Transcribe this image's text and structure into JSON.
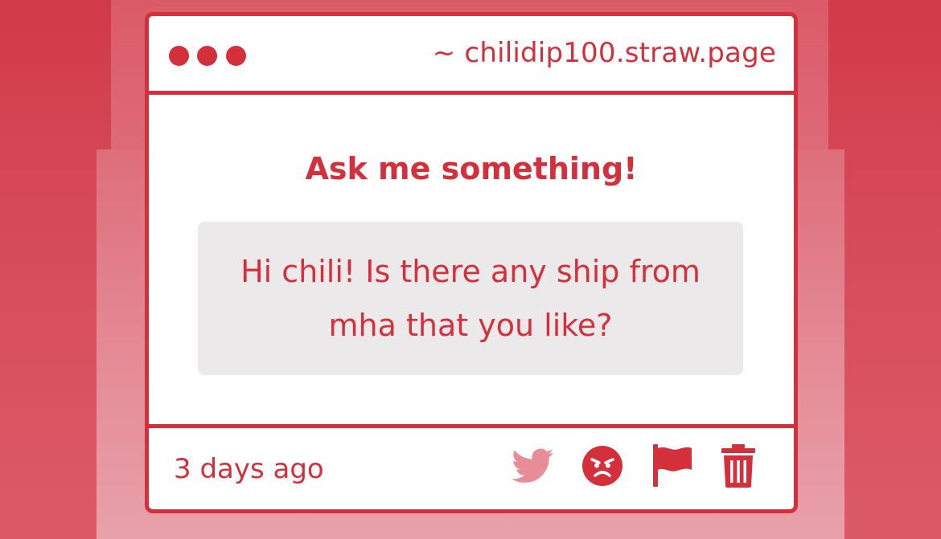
{
  "window": {
    "url": "~ chilidip100.straw.page",
    "accent_color": "#d4303c",
    "dots": [
      "window-dot-1",
      "window-dot-2",
      "window-dot-3"
    ]
  },
  "main": {
    "heading": "Ask me something!",
    "question": "Hi chili! Is there any ship from mha that you like?"
  },
  "footer": {
    "timestamp": "3 days ago",
    "actions": [
      "twitter-icon",
      "angry-face-icon",
      "flag-icon",
      "trash-icon"
    ],
    "twitter_color": "#e88d98"
  }
}
